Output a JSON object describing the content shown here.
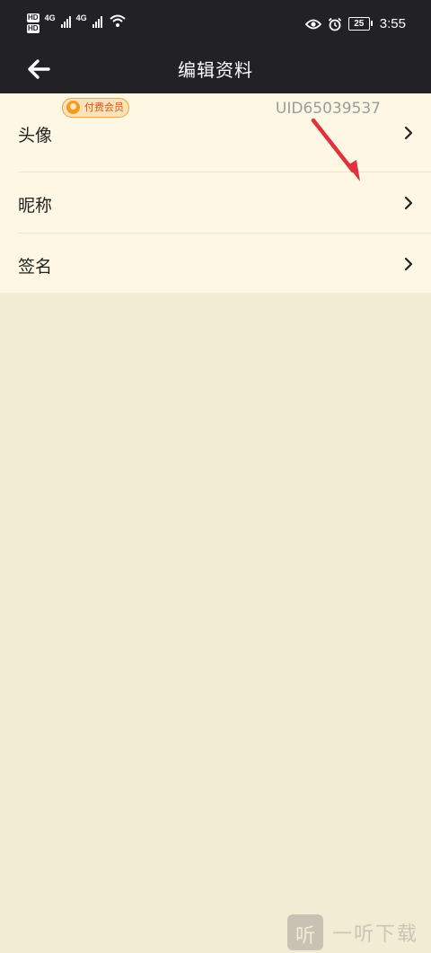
{
  "status_bar": {
    "hd_top": "HD",
    "hd_bottom": "HD",
    "net1": "4G",
    "net2": "4G",
    "battery": "25",
    "time": "3:55"
  },
  "header": {
    "title": "编辑资料"
  },
  "rows": [
    {
      "label": "头像"
    },
    {
      "label": "昵称",
      "badge": "付费会员",
      "value": "UID65039537"
    },
    {
      "label": "签名"
    }
  ],
  "watermark": {
    "icon_char": "听",
    "text": "一听下载"
  },
  "colors": {
    "header_bg": "#222125",
    "list_bg": "#fdf7e4",
    "page_bg": "#f3ecd4",
    "annotation_arrow": "#e0323c"
  }
}
